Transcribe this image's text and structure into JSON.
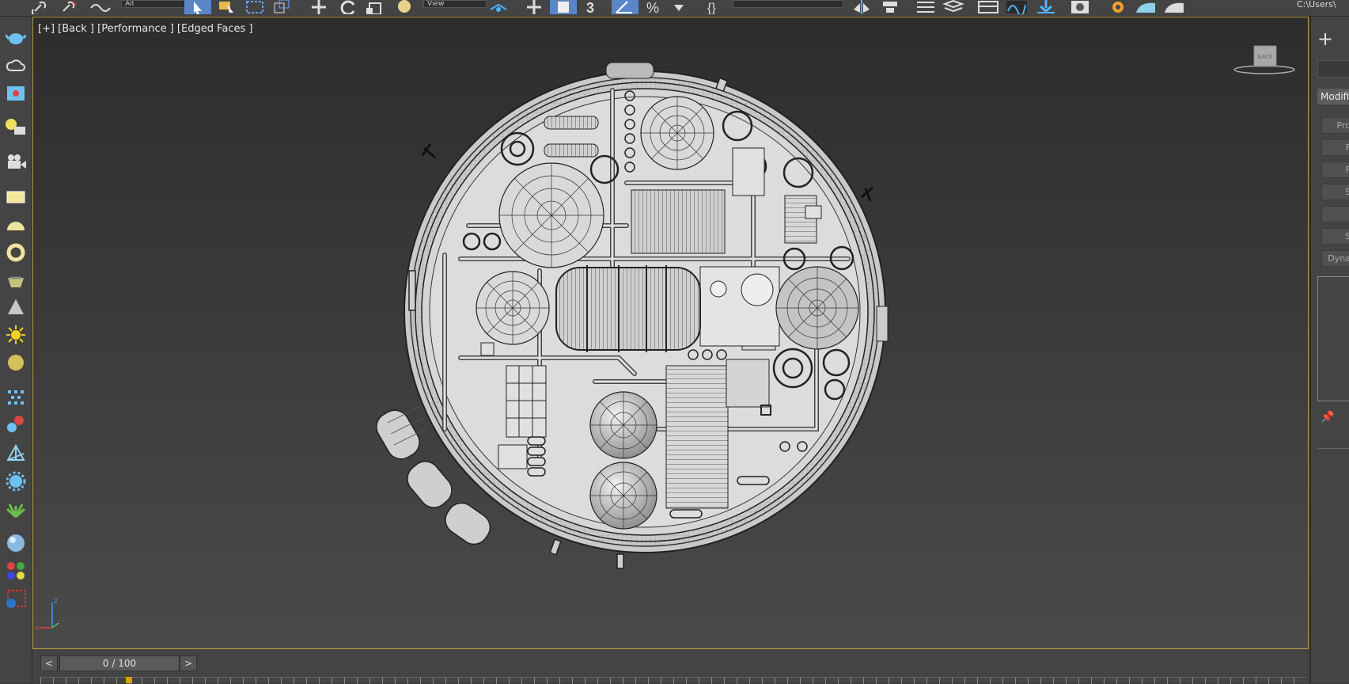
{
  "toolbar": {
    "selection_filter": "All",
    "named_selection": "View",
    "path_text": "C:\\Users\\"
  },
  "viewport": {
    "label": "[+] [Back ] [Performance ] [Edged Faces ]",
    "viewcube_face": "BACK",
    "axis_labels": {
      "z": "z",
      "x": "x"
    }
  },
  "command_panel": {
    "create_symbol": "+",
    "modifier_list": "Modifier List",
    "buttons": [
      "Pro",
      "F",
      "F",
      "S",
      "",
      "S",
      "Dyna"
    ]
  },
  "timeline": {
    "prev": "<",
    "next": ">",
    "frame_display": "0 / 100"
  },
  "left_tools": [
    "teapot-icon",
    "cloud-icon",
    "render-frame-icon",
    "light-list-icon",
    "camera-icon",
    "plane-icon",
    "hemisphere-icon",
    "torus-icon",
    "basket-icon",
    "cone-icon",
    "sun-icon",
    "sphere-icon",
    "particles-icon",
    "dynamics-icon",
    "lattice-icon",
    "gear-icon",
    "foliage-icon",
    "material-sphere-icon",
    "material-map-icon",
    "render-setup-icon"
  ]
}
